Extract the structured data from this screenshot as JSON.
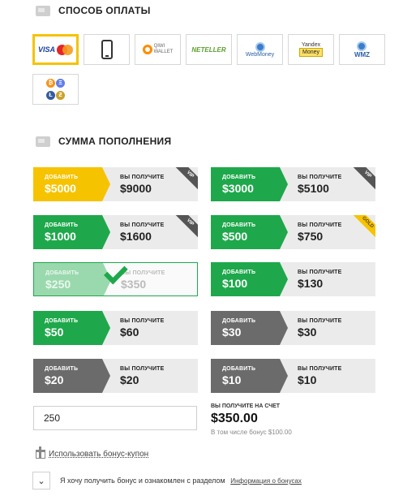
{
  "payment_section": {
    "title": "СПОСОБ ОПЛАТЫ"
  },
  "payment_methods": [
    {
      "id": "visa-mastercard",
      "label": "VISA",
      "sub": "MasterCard",
      "selected": true
    },
    {
      "id": "mobile",
      "label": "",
      "selected": false
    },
    {
      "id": "qiwi",
      "label": "QIWI",
      "sub": "WALLET",
      "selected": false
    },
    {
      "id": "neteller",
      "label": "NETELLER",
      "selected": false
    },
    {
      "id": "webmoney",
      "label": "WebMoney",
      "selected": false
    },
    {
      "id": "yandex",
      "label": "Yandex",
      "sub": "Money",
      "selected": false
    },
    {
      "id": "wmz",
      "label": "WMZ",
      "selected": false
    },
    {
      "id": "crypto",
      "label": "",
      "coins": [
        "₿",
        "Ξ",
        "Ł",
        "Ƶ"
      ],
      "selected": false
    }
  ],
  "amount_section": {
    "title": "СУММА ПОПОЛНЕНИЯ"
  },
  "labels": {
    "add": "ДОБАВИТЬ",
    "receive": "ВЫ ПОЛУЧИТЕ"
  },
  "packages": [
    {
      "add": "$5000",
      "receive": "$9000",
      "color": "yellow",
      "badge": "VIP"
    },
    {
      "add": "$3000",
      "receive": "$5100",
      "color": "green",
      "badge": "VIP"
    },
    {
      "add": "$1000",
      "receive": "$1600",
      "color": "green",
      "badge": "VIP"
    },
    {
      "add": "$500",
      "receive": "$750",
      "color": "green",
      "badge": "GOLD"
    },
    {
      "add": "$250",
      "receive": "$350",
      "color": "green",
      "badge": "",
      "selected": true
    },
    {
      "add": "$100",
      "receive": "$130",
      "color": "green",
      "badge": ""
    },
    {
      "add": "$50",
      "receive": "$60",
      "color": "green",
      "badge": ""
    },
    {
      "add": "$30",
      "receive": "$30",
      "color": "gray",
      "badge": ""
    },
    {
      "add": "$20",
      "receive": "$20",
      "color": "gray",
      "badge": ""
    },
    {
      "add": "$10",
      "receive": "$10",
      "color": "gray",
      "badge": ""
    }
  ],
  "amount_input": {
    "value": "250"
  },
  "summary": {
    "label": "ВЫ ПОЛУЧИТЕ НА СЧЕТ",
    "total": "$350.00",
    "bonus_note": "В том числе бонус $100.00"
  },
  "coupon": {
    "link": "Использовать бонус-купон"
  },
  "agreement": {
    "checked": true,
    "text": "Я хочу получить бонус и ознакомлен с разделом",
    "link": "Информация о бонусах"
  },
  "colors": {
    "yellow": "#f6c300",
    "green": "#1ea84b",
    "gray": "#6b6b6b"
  }
}
